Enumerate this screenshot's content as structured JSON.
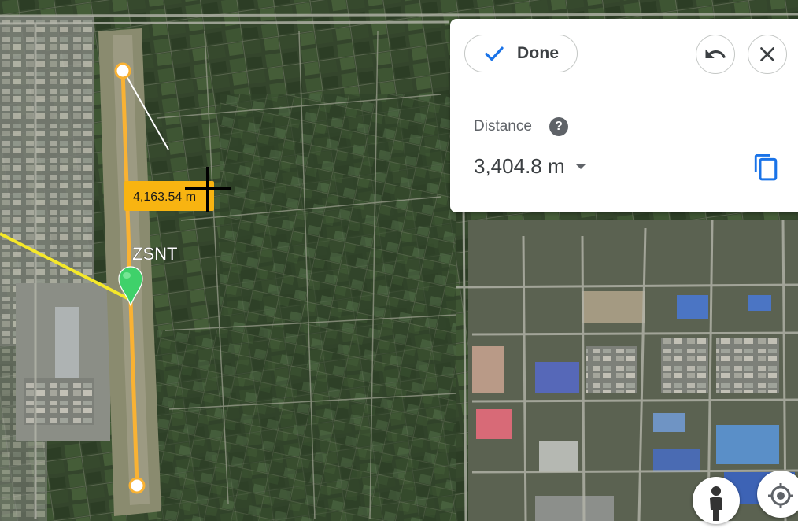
{
  "panel": {
    "done_label": "Done",
    "distance_label": "Distance",
    "help_symbol": "?",
    "distance_value": "3,404.8 m",
    "icons": [
      "check-icon",
      "undo-icon",
      "close-icon",
      "help-icon",
      "chevron-down-icon",
      "copy-icon"
    ]
  },
  "map": {
    "measurement_label": "4,163.54 m",
    "place_label": "ZSNT",
    "colors": {
      "measure_line": "#f9b233",
      "path_line": "#f5e82a",
      "marker": "#3fd16a",
      "label_bg": "#f8b411",
      "accent": "#1a73e8"
    }
  },
  "controls": {
    "icons": [
      "pegman-icon",
      "my-location-icon"
    ]
  }
}
